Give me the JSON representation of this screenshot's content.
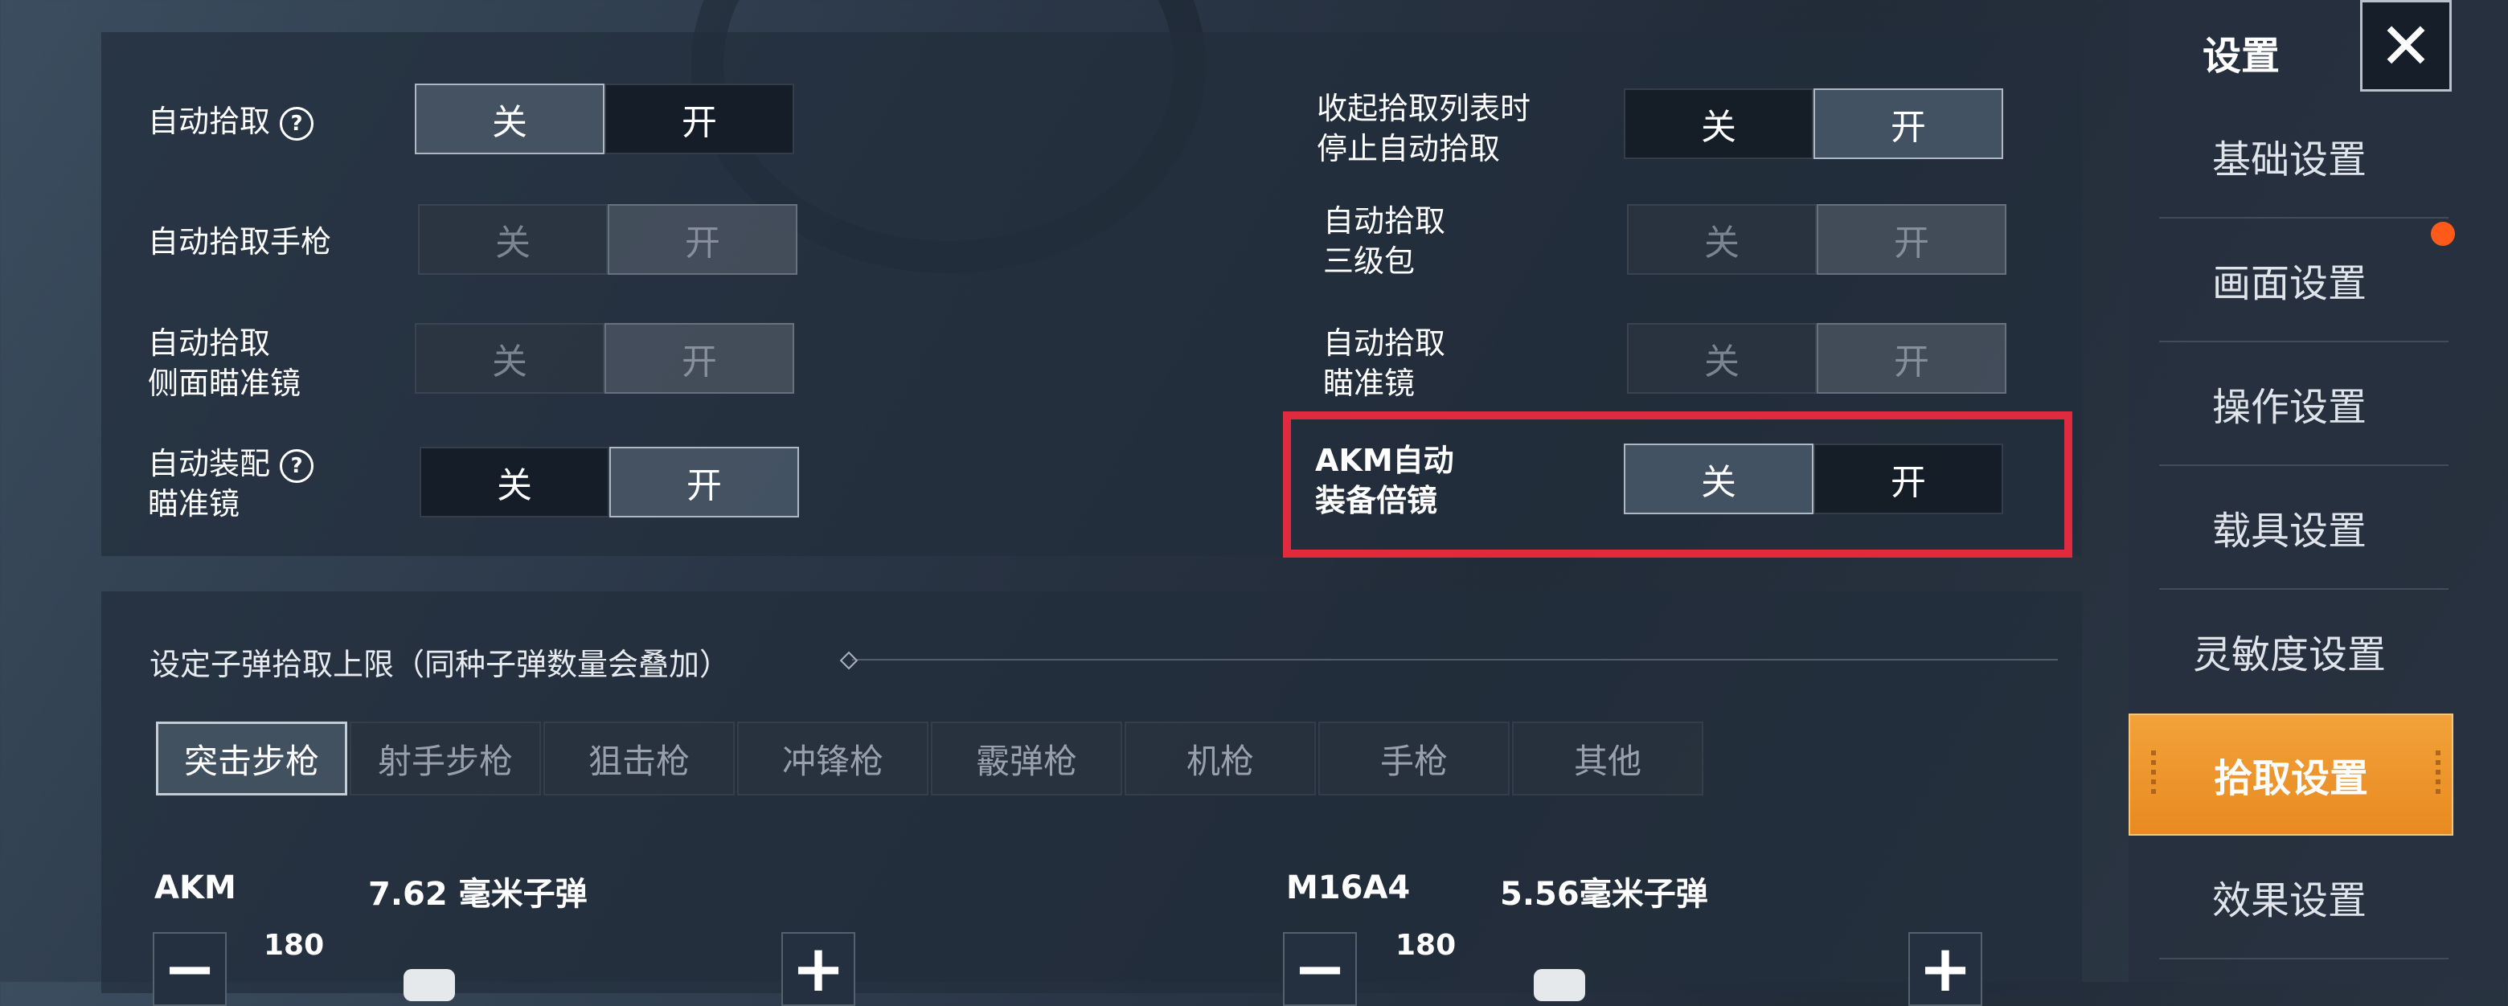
{
  "sidebar": {
    "title": "设置",
    "close_label": "✕",
    "items": [
      {
        "label": "基础设置"
      },
      {
        "label": "画面设置"
      },
      {
        "label": "操作设置"
      },
      {
        "label": "载具设置"
      },
      {
        "label": "灵敏度设置"
      },
      {
        "label": "拾取设置",
        "active": true
      },
      {
        "label": "效果设置"
      }
    ]
  },
  "toggles_left": [
    {
      "label_lines": [
        "自动拾取"
      ],
      "help": true,
      "off": "关",
      "on": "开",
      "selected": "关",
      "enabled": true
    },
    {
      "label_lines": [
        "自动拾取手枪"
      ],
      "help": false,
      "off": "关",
      "on": "开",
      "selected": "开",
      "enabled": false
    },
    {
      "label_lines": [
        "自动拾取",
        "侧面瞄准镜"
      ],
      "help": false,
      "off": "关",
      "on": "开",
      "selected": "开",
      "enabled": false
    },
    {
      "label_lines": [
        "自动装配",
        "瞄准镜"
      ],
      "help": true,
      "off": "关",
      "on": "开",
      "selected": "开",
      "enabled": true
    }
  ],
  "toggles_right": [
    {
      "label_lines": [
        "收起拾取列表时",
        "停止自动拾取"
      ],
      "off": "关",
      "on": "开",
      "selected": "开",
      "enabled": true
    },
    {
      "label_lines": [
        "自动拾取",
        "三级包"
      ],
      "off": "关",
      "on": "开",
      "selected": "开",
      "enabled": false
    },
    {
      "label_lines": [
        "自动拾取",
        "瞄准镜"
      ],
      "off": "关",
      "on": "开",
      "selected": "开",
      "enabled": false
    },
    {
      "label_lines": [
        "AKM自动",
        "装备倍镜"
      ],
      "off": "关",
      "on": "开",
      "selected": "关",
      "enabled": true,
      "highlighted": true
    }
  ],
  "ammo_section": {
    "title": "设定子弹拾取上限（同种子弹数量会叠加）",
    "tabs": [
      "突击步枪",
      "射手步枪",
      "狙击枪",
      "冲锋枪",
      "霰弹枪",
      "机枪",
      "手枪",
      "其他"
    ],
    "active_tab": "突击步枪",
    "guns": [
      {
        "name": "AKM",
        "ammo": "7.62 毫米子弹",
        "count": "180",
        "minus": "−",
        "plus": "+"
      },
      {
        "name": "M16A4",
        "ammo": "5.56毫米子弹",
        "count": "180",
        "minus": "−",
        "plus": "+"
      }
    ]
  },
  "colors": {
    "highlight": "#e02a3f",
    "active_tab_orange": "#f2a23a",
    "notify_dot": "#ff5a1a"
  }
}
